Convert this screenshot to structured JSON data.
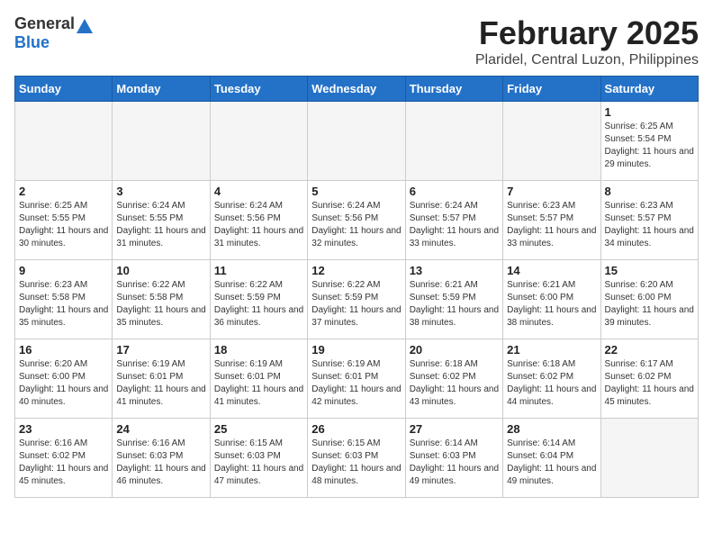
{
  "header": {
    "logo_general": "General",
    "logo_blue": "Blue",
    "month_title": "February 2025",
    "location": "Plaridel, Central Luzon, Philippines"
  },
  "weekdays": [
    "Sunday",
    "Monday",
    "Tuesday",
    "Wednesday",
    "Thursday",
    "Friday",
    "Saturday"
  ],
  "weeks": [
    [
      {
        "day": "",
        "empty": true
      },
      {
        "day": "",
        "empty": true
      },
      {
        "day": "",
        "empty": true
      },
      {
        "day": "",
        "empty": true
      },
      {
        "day": "",
        "empty": true
      },
      {
        "day": "",
        "empty": true
      },
      {
        "day": "1",
        "sunrise": "6:25 AM",
        "sunset": "5:54 PM",
        "daylight": "11 hours and 29 minutes."
      }
    ],
    [
      {
        "day": "2",
        "sunrise": "6:25 AM",
        "sunset": "5:55 PM",
        "daylight": "11 hours and 30 minutes."
      },
      {
        "day": "3",
        "sunrise": "6:24 AM",
        "sunset": "5:55 PM",
        "daylight": "11 hours and 31 minutes."
      },
      {
        "day": "4",
        "sunrise": "6:24 AM",
        "sunset": "5:56 PM",
        "daylight": "11 hours and 31 minutes."
      },
      {
        "day": "5",
        "sunrise": "6:24 AM",
        "sunset": "5:56 PM",
        "daylight": "11 hours and 32 minutes."
      },
      {
        "day": "6",
        "sunrise": "6:24 AM",
        "sunset": "5:57 PM",
        "daylight": "11 hours and 33 minutes."
      },
      {
        "day": "7",
        "sunrise": "6:23 AM",
        "sunset": "5:57 PM",
        "daylight": "11 hours and 33 minutes."
      },
      {
        "day": "8",
        "sunrise": "6:23 AM",
        "sunset": "5:57 PM",
        "daylight": "11 hours and 34 minutes."
      }
    ],
    [
      {
        "day": "9",
        "sunrise": "6:23 AM",
        "sunset": "5:58 PM",
        "daylight": "11 hours and 35 minutes."
      },
      {
        "day": "10",
        "sunrise": "6:22 AM",
        "sunset": "5:58 PM",
        "daylight": "11 hours and 35 minutes."
      },
      {
        "day": "11",
        "sunrise": "6:22 AM",
        "sunset": "5:59 PM",
        "daylight": "11 hours and 36 minutes."
      },
      {
        "day": "12",
        "sunrise": "6:22 AM",
        "sunset": "5:59 PM",
        "daylight": "11 hours and 37 minutes."
      },
      {
        "day": "13",
        "sunrise": "6:21 AM",
        "sunset": "5:59 PM",
        "daylight": "11 hours and 38 minutes."
      },
      {
        "day": "14",
        "sunrise": "6:21 AM",
        "sunset": "6:00 PM",
        "daylight": "11 hours and 38 minutes."
      },
      {
        "day": "15",
        "sunrise": "6:20 AM",
        "sunset": "6:00 PM",
        "daylight": "11 hours and 39 minutes."
      }
    ],
    [
      {
        "day": "16",
        "sunrise": "6:20 AM",
        "sunset": "6:00 PM",
        "daylight": "11 hours and 40 minutes."
      },
      {
        "day": "17",
        "sunrise": "6:19 AM",
        "sunset": "6:01 PM",
        "daylight": "11 hours and 41 minutes."
      },
      {
        "day": "18",
        "sunrise": "6:19 AM",
        "sunset": "6:01 PM",
        "daylight": "11 hours and 41 minutes."
      },
      {
        "day": "19",
        "sunrise": "6:19 AM",
        "sunset": "6:01 PM",
        "daylight": "11 hours and 42 minutes."
      },
      {
        "day": "20",
        "sunrise": "6:18 AM",
        "sunset": "6:02 PM",
        "daylight": "11 hours and 43 minutes."
      },
      {
        "day": "21",
        "sunrise": "6:18 AM",
        "sunset": "6:02 PM",
        "daylight": "11 hours and 44 minutes."
      },
      {
        "day": "22",
        "sunrise": "6:17 AM",
        "sunset": "6:02 PM",
        "daylight": "11 hours and 45 minutes."
      }
    ],
    [
      {
        "day": "23",
        "sunrise": "6:16 AM",
        "sunset": "6:02 PM",
        "daylight": "11 hours and 45 minutes."
      },
      {
        "day": "24",
        "sunrise": "6:16 AM",
        "sunset": "6:03 PM",
        "daylight": "11 hours and 46 minutes."
      },
      {
        "day": "25",
        "sunrise": "6:15 AM",
        "sunset": "6:03 PM",
        "daylight": "11 hours and 47 minutes."
      },
      {
        "day": "26",
        "sunrise": "6:15 AM",
        "sunset": "6:03 PM",
        "daylight": "11 hours and 48 minutes."
      },
      {
        "day": "27",
        "sunrise": "6:14 AM",
        "sunset": "6:03 PM",
        "daylight": "11 hours and 49 minutes."
      },
      {
        "day": "28",
        "sunrise": "6:14 AM",
        "sunset": "6:04 PM",
        "daylight": "11 hours and 49 minutes."
      },
      {
        "day": "",
        "empty": true
      }
    ]
  ]
}
